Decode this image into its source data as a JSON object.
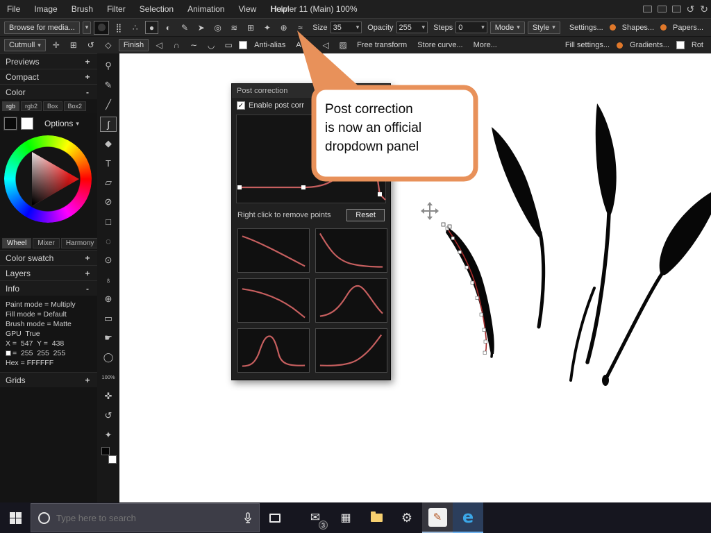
{
  "ui": {
    "caret": "▾",
    "undo": "↺",
    "redo": "↻",
    "check": "✓",
    "dot": ""
  },
  "menubar": {
    "items": [
      "File",
      "Image",
      "Brush",
      "Filter",
      "Selection",
      "Animation",
      "View",
      "Help"
    ],
    "title": "Howler 11 (Main)  100%"
  },
  "toolbar_main": {
    "browse_label": "Browse for media...",
    "icons": [
      {
        "name": "dots-icon",
        "glyph": "⣿"
      },
      {
        "name": "spray-icon",
        "glyph": "∴"
      },
      {
        "name": "round-brush-icon",
        "glyph": "●"
      },
      {
        "name": "soft-round-icon",
        "glyph": "◐"
      },
      {
        "name": "pencil-icon",
        "glyph": "✎"
      },
      {
        "name": "knife-icon",
        "glyph": "➤"
      },
      {
        "name": "donut-icon",
        "glyph": "◎"
      },
      {
        "name": "wave-icon",
        "glyph": "≋"
      },
      {
        "name": "mirror-icon",
        "glyph": "⊞"
      },
      {
        "name": "particle-icon",
        "glyph": "✦"
      },
      {
        "name": "nozzle-icon",
        "glyph": "⊕"
      },
      {
        "name": "post-correction-icon",
        "glyph": "≈"
      }
    ],
    "size_label": "Size",
    "size_value": "35",
    "opacity_label": "Opacity",
    "opacity_value": "255",
    "steps_label": "Steps",
    "steps_value": "0",
    "mode_label": "Mode",
    "style_label": "Style",
    "settings_label": "Settings...",
    "shapes_label": "Shapes...",
    "papers_label": "Papers..."
  },
  "toolbar_curve": {
    "spline_type": "Cutmull",
    "finish_label": "Finish",
    "antialias_label": "Anti-alias",
    "auto_label": "Auto",
    "free_transform_label": "Free transform",
    "store_curve_label": "Store curve...",
    "more_label": "More...",
    "fill_settings_label": "Fill settings...",
    "gradients_label": "Gradients...",
    "rot_label": "Rot",
    "pre_icons": [
      {
        "name": "add-node-icon",
        "glyph": "✛"
      },
      {
        "name": "edit-node-icon",
        "glyph": "⊞"
      },
      {
        "name": "undo-node-icon",
        "glyph": "↺"
      },
      {
        "name": "close-path-icon",
        "glyph": "◇"
      }
    ],
    "shape_icons": [
      {
        "name": "freehand-icon",
        "glyph": "◁"
      },
      {
        "name": "arc-icon",
        "glyph": "∩"
      },
      {
        "name": "scurve-icon",
        "glyph": "∼"
      },
      {
        "name": "loop-icon",
        "glyph": "◡"
      },
      {
        "name": "rect-icon",
        "glyph": "▭"
      }
    ],
    "mode_icons": [
      {
        "name": "triangle-fill-icon",
        "glyph": "◁"
      },
      {
        "name": "hatch-icon",
        "glyph": "▨"
      }
    ]
  },
  "toolstrip": {
    "tools": [
      {
        "name": "pin-tool",
        "glyph": "⚲"
      },
      {
        "name": "brush-tool",
        "glyph": "✎"
      },
      {
        "name": "line-tool",
        "glyph": "╱"
      },
      {
        "name": "curve-tool",
        "glyph": "∫"
      },
      {
        "name": "polygon-tool",
        "glyph": "◆"
      },
      {
        "name": "text-tool",
        "glyph": "T"
      },
      {
        "name": "shear-tool",
        "glyph": "▱"
      },
      {
        "name": "ellipse-tool",
        "glyph": "⊘"
      },
      {
        "name": "rect-select-tool",
        "glyph": "□"
      },
      {
        "name": "circle-select-tool",
        "glyph": "◌"
      },
      {
        "name": "zoom-tool",
        "glyph": "⊙"
      },
      {
        "name": "dropper-tool",
        "glyph": "♁"
      },
      {
        "name": "clone-tool",
        "glyph": "⊕"
      },
      {
        "name": "capsule-tool",
        "glyph": "▭"
      },
      {
        "name": "hand-tool",
        "glyph": "☛"
      },
      {
        "name": "bulb-tool",
        "glyph": "◯"
      },
      {
        "name": "zoom-level",
        "glyph": "100%"
      },
      {
        "name": "move-tool",
        "glyph": "✜"
      },
      {
        "name": "undo-tool",
        "glyph": "↺"
      },
      {
        "name": "star-tool",
        "glyph": "✦"
      }
    ]
  },
  "sidebar": {
    "panels": [
      {
        "label": "Previews",
        "exp": "+"
      },
      {
        "label": "Compact",
        "exp": "+"
      },
      {
        "label": "Color",
        "exp": "-"
      },
      {
        "label": "Color swatch",
        "exp": "+"
      },
      {
        "label": "Layers",
        "exp": "+"
      },
      {
        "label": "Info",
        "exp": "-"
      },
      {
        "label": "Grids",
        "exp": "+"
      }
    ],
    "color_tabs": [
      "rgb",
      "rgb2",
      "Box",
      "Box2"
    ],
    "options_label": "Options",
    "wheel_tabs": [
      "Wheel",
      "Mixer",
      "Harmony"
    ],
    "info_lines": [
      "Paint mode = Multiply",
      "Fill mode = Default",
      "Brush mode = Matte",
      "GPU  True",
      "X =  547  Y =  438",
      "=  255  255  255",
      "Hex = FFFFFF"
    ]
  },
  "post_panel": {
    "title": "Post correction",
    "enable_label": "Enable post corr",
    "hint": "Right click to remove points",
    "reset_label": "Reset"
  },
  "callout": {
    "lines": [
      "Post correction",
      "is now an official",
      "dropdown panel"
    ],
    "accent": "#e8915a"
  },
  "taskbar": {
    "search_placeholder": "Type here to search",
    "badge": "3",
    "icons": {
      "pencil": "✎",
      "mail": "✉",
      "grid": "▦",
      "gear": "⚙",
      "edge": "e"
    }
  }
}
